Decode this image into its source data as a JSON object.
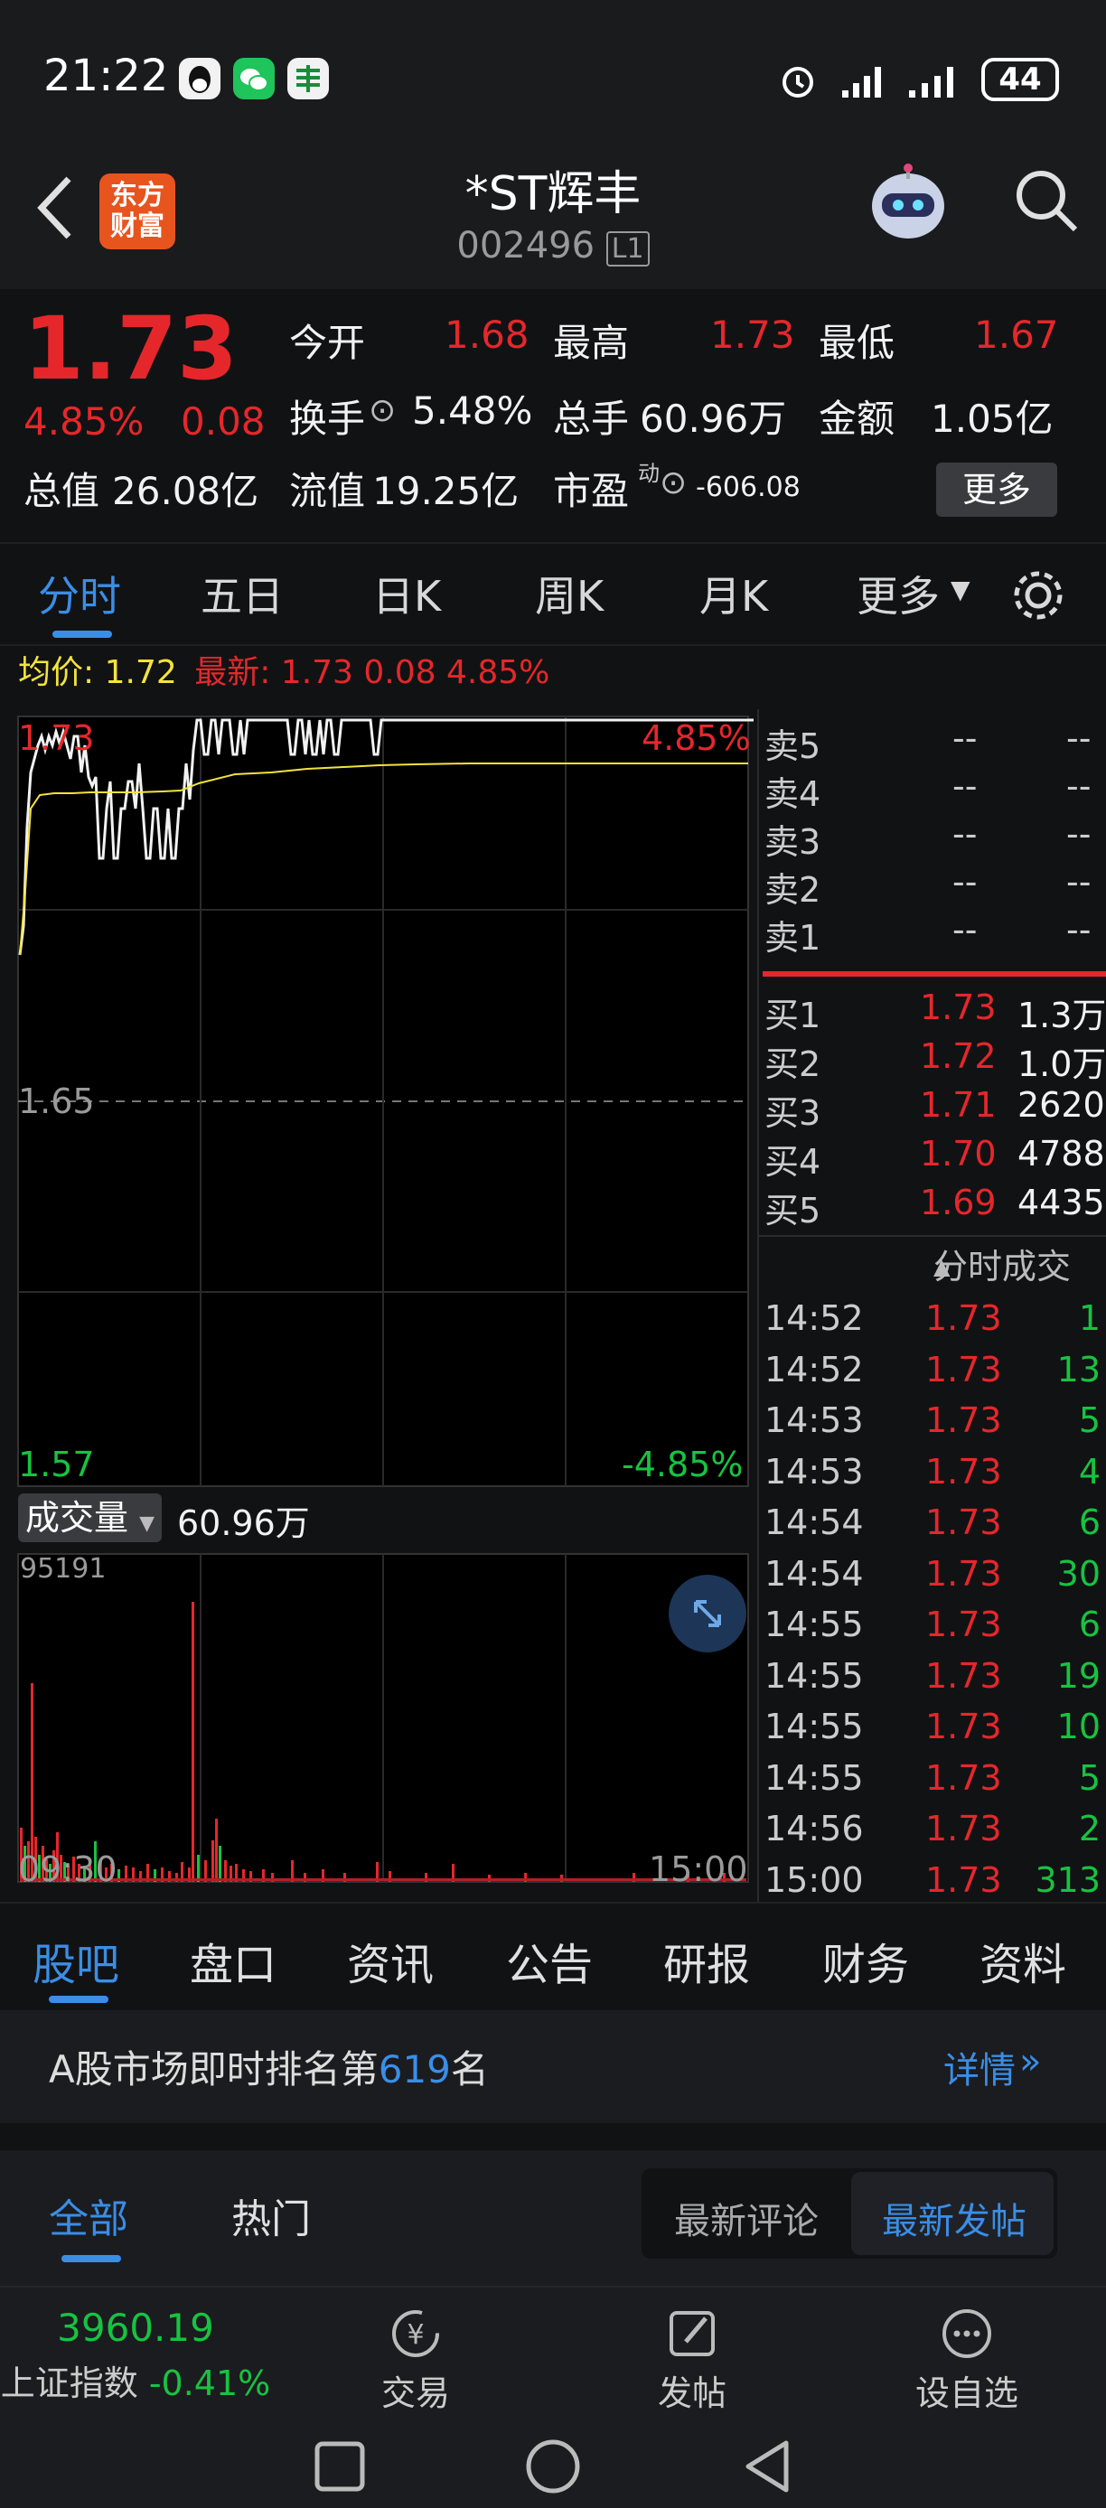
{
  "status_bar": {
    "time": "21:22",
    "battery": "44",
    "icons": [
      "qq-icon",
      "wechat-icon",
      "bank-icon",
      "alarm-icon",
      "signal-icon",
      "signal-icon",
      "battery-icon"
    ]
  },
  "header": {
    "back_icon": "chevron-left-icon",
    "logo_line1": "东方",
    "logo_line2": "财富",
    "stock_name": "*ST辉丰",
    "stock_code": "002496",
    "level_badge": "L1",
    "assistant_icon": "robot-avatar-icon",
    "search_icon": "search-icon"
  },
  "quote": {
    "price": "1.73",
    "change_pct": "4.85%",
    "change": "0.08",
    "open_label": "今开",
    "open": "1.68",
    "high_label": "最高",
    "high": "1.73",
    "low_label": "最低",
    "low": "1.67",
    "turnover_label": "换手",
    "turnover": "5.48%",
    "volume_label": "总手",
    "volume": "60.96万",
    "amount_label": "金额",
    "amount": "1.05亿",
    "mktcap_label": "总值",
    "mktcap": "26.08亿",
    "float_label": "流值",
    "float_cap": "19.25亿",
    "pe_label": "市盈",
    "pe_sup": "动",
    "pe": "-606.08",
    "more_button": "更多"
  },
  "chart_tabs": {
    "items": [
      "分时",
      "五日",
      "日K",
      "周K",
      "月K",
      "更多"
    ],
    "active": "分时"
  },
  "legend": {
    "avg_label": "均价:",
    "avg": "1.72",
    "last_label": "最新:",
    "last": "1.73",
    "last_change": "0.08",
    "last_pct": "4.85%"
  },
  "price_axis": {
    "top": "1.73",
    "mid": "1.65",
    "bottom": "1.57",
    "top_pct": "4.85%",
    "bottom_pct": "-4.85%"
  },
  "volume_panel": {
    "selector": "成交量",
    "total": "60.96万",
    "max": "95191",
    "start_time": "09:30",
    "end_time": "15:00"
  },
  "order_book": {
    "asks": [
      {
        "label": "卖5",
        "price": "--",
        "vol": "--"
      },
      {
        "label": "卖4",
        "price": "--",
        "vol": "--"
      },
      {
        "label": "卖3",
        "price": "--",
        "vol": "--"
      },
      {
        "label": "卖2",
        "price": "--",
        "vol": "--"
      },
      {
        "label": "卖1",
        "price": "--",
        "vol": "--"
      }
    ],
    "bids": [
      {
        "label": "买1",
        "price": "1.73",
        "vol": "1.3万"
      },
      {
        "label": "买2",
        "price": "1.72",
        "vol": "1.0万"
      },
      {
        "label": "买3",
        "price": "1.71",
        "vol": "2620"
      },
      {
        "label": "买4",
        "price": "1.70",
        "vol": "4788"
      },
      {
        "label": "买5",
        "price": "1.69",
        "vol": "4435"
      }
    ]
  },
  "trades": {
    "title": "分时成交",
    "rows": [
      {
        "time": "14:52",
        "price": "1.73",
        "vol": "1"
      },
      {
        "time": "14:52",
        "price": "1.73",
        "vol": "13"
      },
      {
        "time": "14:53",
        "price": "1.73",
        "vol": "5"
      },
      {
        "time": "14:53",
        "price": "1.73",
        "vol": "4"
      },
      {
        "time": "14:54",
        "price": "1.73",
        "vol": "6"
      },
      {
        "time": "14:54",
        "price": "1.73",
        "vol": "30"
      },
      {
        "time": "14:55",
        "price": "1.73",
        "vol": "6"
      },
      {
        "time": "14:55",
        "price": "1.73",
        "vol": "19"
      },
      {
        "time": "14:55",
        "price": "1.73",
        "vol": "10"
      },
      {
        "time": "14:55",
        "price": "1.73",
        "vol": "5"
      },
      {
        "time": "14:56",
        "price": "1.73",
        "vol": "2"
      },
      {
        "time": "15:00",
        "price": "1.73",
        "vol": "313"
      }
    ]
  },
  "bottom_tabs": {
    "items": [
      "股吧",
      "盘口",
      "资讯",
      "公告",
      "研报",
      "财务",
      "资料"
    ],
    "active": "股吧"
  },
  "rank": {
    "prefix": "A股市场即时排名第",
    "number": "619",
    "suffix": "名",
    "link": "详情"
  },
  "feed_tabs": {
    "left": [
      "全部",
      "热门"
    ],
    "active": "全部",
    "sort": [
      "最新评论",
      "最新发帖"
    ],
    "sort_active": "最新发帖"
  },
  "bottom_bar": {
    "index_value": "3960.19",
    "index_name": "上证指数",
    "index_change": "-0.41%",
    "trade": "交易",
    "post": "发帖",
    "watch": "设自选"
  },
  "colors": {
    "up": "#e5272b",
    "down": "#17c341",
    "accent": "#3a8ee6",
    "avg_line": "#f5e33c"
  }
}
